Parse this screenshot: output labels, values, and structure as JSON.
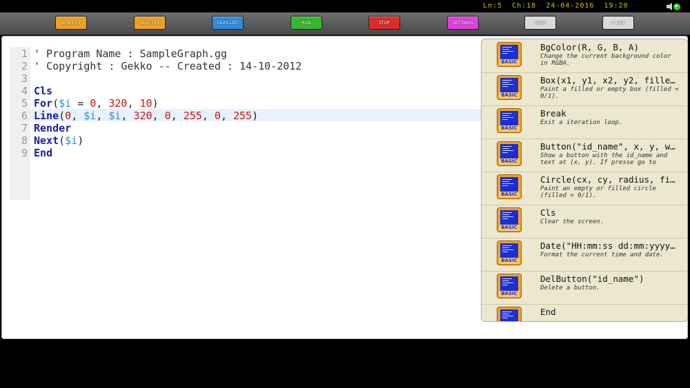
{
  "status": {
    "line": "Ln:5",
    "col": "Ch:18",
    "date": "24-04-2016",
    "time": "19:20"
  },
  "toolbar": [
    {
      "label": "NEW FILE",
      "color": "#f0a020"
    },
    {
      "label": "SAVE FILE",
      "color": "#f0a020"
    },
    {
      "label": "FILES LIST",
      "color": "#2e8ee0"
    },
    {
      "label": "RUN",
      "color": "#38b830"
    },
    {
      "label": "STOP",
      "color": "#e02a2a"
    },
    {
      "label": "SETTINGS",
      "color": "#e040e0"
    },
    {
      "label": "HELP",
      "color": "#dadada"
    },
    {
      "label": "F. LIST",
      "color": "#dadada"
    }
  ],
  "editor": {
    "line_numbers": [
      "1",
      "2",
      "3",
      "4",
      "5",
      "6",
      "7",
      "8",
      "9"
    ],
    "current_line": 6,
    "lines": [
      [
        {
          "t": "' Program Name : SampleGraph.gg",
          "c": "cmt"
        }
      ],
      [
        {
          "t": "' Copyright : Gekko -- Created : 14-10-2012",
          "c": "cmt"
        }
      ],
      [],
      [
        {
          "t": "Cls",
          "c": "kw"
        }
      ],
      [
        {
          "t": "For",
          "c": "kw"
        },
        {
          "t": "(",
          "c": ""
        },
        {
          "t": "$i",
          "c": "var"
        },
        {
          "t": " = ",
          "c": ""
        },
        {
          "t": "0",
          "c": "num"
        },
        {
          "t": ", ",
          "c": ""
        },
        {
          "t": "320",
          "c": "num"
        },
        {
          "t": ", ",
          "c": ""
        },
        {
          "t": "10",
          "c": "num"
        },
        {
          "t": ")",
          "c": ""
        }
      ],
      [
        {
          "t": "Line",
          "c": "kw"
        },
        {
          "t": "(",
          "c": ""
        },
        {
          "t": "0",
          "c": "num"
        },
        {
          "t": ", ",
          "c": ""
        },
        {
          "t": "$i",
          "c": "var"
        },
        {
          "t": ", ",
          "c": ""
        },
        {
          "t": "$i",
          "c": "var"
        },
        {
          "t": ", ",
          "c": ""
        },
        {
          "t": "320",
          "c": "num"
        },
        {
          "t": ", ",
          "c": ""
        },
        {
          "t": "0",
          "c": "num"
        },
        {
          "t": ", ",
          "c": ""
        },
        {
          "t": "255",
          "c": "num"
        },
        {
          "t": ", ",
          "c": ""
        },
        {
          "t": "0",
          "c": "num"
        },
        {
          "t": ", ",
          "c": ""
        },
        {
          "t": "255",
          "c": "num"
        },
        {
          "t": ")",
          "c": ""
        }
      ],
      [
        {
          "t": "Render",
          "c": "kw"
        }
      ],
      [
        {
          "t": "Next",
          "c": "kw"
        },
        {
          "t": "(",
          "c": ""
        },
        {
          "t": "$i",
          "c": "var"
        },
        {
          "t": ")",
          "c": ""
        }
      ],
      [
        {
          "t": "End",
          "c": "kw"
        }
      ]
    ]
  },
  "functions": {
    "icon_label": "BASIC",
    "items": [
      {
        "name": "BgColor(R, G, B, A)",
        "desc": "Change the current background color in RGBA."
      },
      {
        "name": "Box(x1, y1, x2, y2, fille…",
        "desc": "Paint a filled or empty box (filled = 0/1)."
      },
      {
        "name": "Break",
        "desc": "Exit a iteration loop."
      },
      {
        "name": "Button(\"id_name\", x, y, w…",
        "desc": "Show a button with the id_name and text at (x, y). If presse go to"
      },
      {
        "name": "Circle(cx, cy, radius, fi…",
        "desc": "Paint an empty or filled circle (filled = 0/1)."
      },
      {
        "name": "Cls",
        "desc": "Clear the screen."
      },
      {
        "name": "Date(\"HH:mm:ss dd:mm:yyyy…",
        "desc": "Format the current time and date."
      },
      {
        "name": "DelButton(\"id_name\")",
        "desc": "Delete a button."
      },
      {
        "name": "End",
        "desc": ""
      }
    ]
  }
}
